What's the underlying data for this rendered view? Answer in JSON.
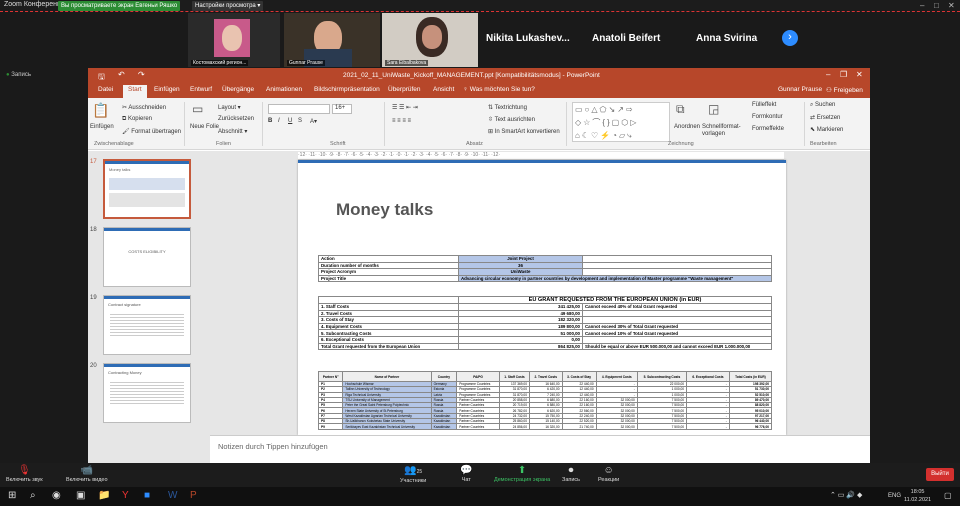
{
  "zoom": {
    "app_title": "Zoom Конференция",
    "banner_green": "Вы просматриваете экран Евгеньи Ряшко",
    "banner_options": "Настройки просмотра",
    "participants": [
      {
        "name": "Костомахский регион..."
      },
      {
        "name": "Gunnar Prause"
      },
      {
        "name": "Sara Eibalbakova"
      }
    ],
    "big_names": [
      "Nikita Lukashev...",
      "Anatoli Beifert",
      "Anna Svirina"
    ],
    "share_label": "Запись",
    "bottom_bar": {
      "mute": "Включить звук",
      "video": "Включить видео",
      "participants": "Участники",
      "participants_count": "25",
      "chat": "Чат",
      "share_screen": "Демонстрация экрана",
      "record": "Запись",
      "reactions": "Реакции",
      "end": "Выйти"
    }
  },
  "ppt": {
    "title": "2021_02_11_UniWaste_Kickoff_MANAGEMENT.ppt [Kompatibilitätsmodus] - PowerPoint",
    "user": "Gunnar Prause",
    "share": "Freigeben",
    "tabs": [
      "Datei",
      "Start",
      "Einfügen",
      "Entwurf",
      "Übergänge",
      "Animationen",
      "Bildschirmpräsentation",
      "Überprüfen",
      "Ansicht"
    ],
    "tell_me": "Was möchten Sie tun?",
    "ribbon": {
      "paste": "Einfügen",
      "cut": "Ausschneiden",
      "copy": "Kopieren",
      "format_painter": "Format übertragen",
      "clipboard_group": "Zwischenablage",
      "new_slide": "Neue Folie",
      "layout": "Layout",
      "reset": "Zurücksetzen",
      "section": "Abschnitt",
      "slides_group": "Folien",
      "font_group": "Schrift",
      "font_size": "16+",
      "text_direction": "Textrichtung",
      "align_text": "Text ausrichten",
      "smartart": "In SmartArt konvertieren",
      "paragraph_group": "Absatz",
      "arrange": "Anordnen",
      "quick_styles": "Schnellformat-vorlagen",
      "fill": "Fülleffekt",
      "outline": "Formkontur",
      "effects": "Formeffekte",
      "drawing_group": "Zeichnung",
      "find": "Suchen",
      "replace": "Ersetzen",
      "select": "Markieren",
      "editing_group": "Bearbeiten"
    },
    "slides": [
      {
        "num": "17",
        "title": "Money talks"
      },
      {
        "num": "18",
        "title": "COSTS ELIGIBILITY"
      },
      {
        "num": "19",
        "title": "Contract signature"
      },
      {
        "num": "20",
        "title": "Contracting Money"
      }
    ],
    "notes_placeholder": "Notizen durch Tippen hinzufügen",
    "ruler": "·12· ·11· ·10· ·9· ·8· ·7· ·6· ·5· ·4· ·3· ·2· ·1· ·0· ·1· ·2· ·3· ·4· ·5· ·6· ·7· ·8· ·9· ·10· ·11· ·12·"
  },
  "slide": {
    "heading": "Money talks",
    "project": [
      {
        "label": "Action",
        "value": "Joint Project"
      },
      {
        "label": "Duration number of months",
        "value": "36"
      },
      {
        "label": "Project Acronym",
        "value": "UniWaste"
      },
      {
        "label": "Project Title",
        "value": "Advancing circular economy in partner countries by development and implementation of Master programme \"Waste management\""
      }
    ],
    "grant_header": "EU GRANT REQUESTED FROM THE EUROPEAN UNION (in EUR)",
    "grant_rows": [
      {
        "label": "1. Staff Costs",
        "value": "341 425,00",
        "note": "Cannot exceed 40% of total Grant requested"
      },
      {
        "label": "2. Travel Costs",
        "value": "49 680,00",
        "note": ""
      },
      {
        "label": "3. Costs of Stay",
        "value": "182 320,00",
        "note": ""
      },
      {
        "label": "4. Equipment Costs",
        "value": "189 800,00",
        "note": "Cannot exceed 30% of Total Grant requested"
      },
      {
        "label": "5. Subcontracting Costs",
        "value": "51 000,00",
        "note": "Cannot exceed 10% of Total Grant requested"
      },
      {
        "label": "6. Exceptional Costs",
        "value": "0,00",
        "note": ""
      }
    ],
    "grant_total": {
      "label": "Total Grant requested from the European Union",
      "value": "864 825,00",
      "note": "Should be equal or above EUR 500.000,00 and cannot exceed EUR 1.000.000,00"
    },
    "partner_headers": [
      "Partner N°",
      "Name of Partner",
      "Country",
      "PA/PG",
      "1. Staff Costs",
      "2. Travel Costs",
      "3. Costs of Stay",
      "4. Equipment Costs",
      "5. Subcontracting Costs",
      "6. Exceptional Costs",
      "Total Costs (in EUR)"
    ],
    "partners": [
      [
        "P1",
        "Hochschule Wismar",
        "Germany",
        "Programme Countries",
        "137 369,00",
        "16 640,00",
        "22 440,00",
        "-",
        "22 000,00",
        "-",
        "198 392,00"
      ],
      [
        "P2",
        "Tallinn University of Technology",
        "Estonia",
        "Programme Countries",
        "31 870,00",
        "6 420,00",
        "12 440,00",
        "-",
        "1 000,00",
        "-",
        "51 730,00"
      ],
      [
        "P3",
        "Riga Technical University",
        "Latvia",
        "Programme Countries",
        "31 870,00",
        "7 240,00",
        "12 440,00",
        "-",
        "1 000,00",
        "-",
        "52 510,00"
      ],
      [
        "P4",
        "TSU University of Management",
        "Russia",
        "Partner Countries",
        "20 858,00",
        "6 680,00",
        "22 160,00",
        "32 000,00",
        "7 500,00",
        "-",
        "89 470,00"
      ],
      [
        "P5",
        "Peter the Great Saint Petersburg Polytechnic",
        "Russia",
        "Partner Countries",
        "20 719,00",
        "6 580,00",
        "22 160,00",
        "32 000,00",
        "7 500,00",
        "-",
        "88 820,00"
      ],
      [
        "P6",
        "Herzen State University of St.Petersburg",
        "Russia",
        "Partner Countries",
        "26 782,00",
        "6 620,00",
        "22 560,00",
        "32 000,00",
        "7 500,00",
        "-",
        "95 010,00"
      ],
      [
        "P7",
        "West Kazakhstan Agrarian Technical University",
        "Kazakhstan",
        "Partner Countries",
        "24 732,00",
        "15 750,00",
        "22 240,00",
        "32 000,00",
        "7 500,00",
        "-",
        "97 217,00"
      ],
      [
        "P8",
        "Sh.Ualikhanov Kokshetau State University",
        "Kazakhstan",
        "Partner Countries",
        "25 860,00",
        "15 140,00",
        "22 520,00",
        "32 000,00",
        "7 500,00",
        "-",
        "96 440,00"
      ],
      [
        "P9",
        "Serikbayev East Kazakhstan Technical University",
        "Kazakhstan",
        "Partner Countries",
        "24 856,00",
        "16 320,00",
        "21 740,00",
        "32 000,00",
        "7 500,00",
        "-",
        "96 776,00"
      ]
    ]
  },
  "taskbar": {
    "lang": "ENG",
    "time": "18:05",
    "date": "11.02.2021"
  }
}
